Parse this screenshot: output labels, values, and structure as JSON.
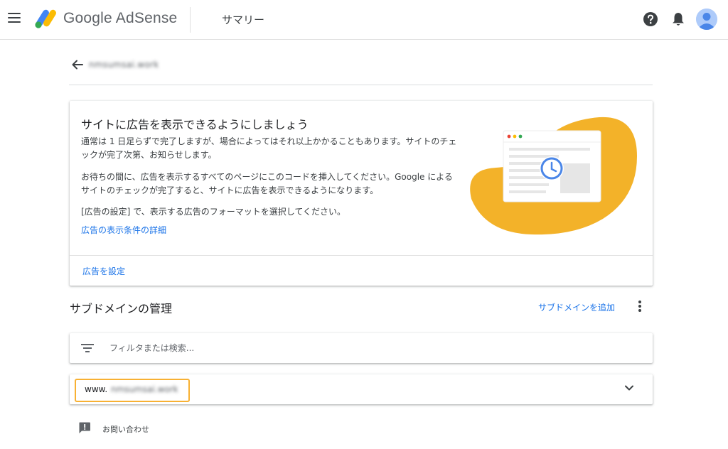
{
  "header": {
    "brand": "Google AdSense",
    "page_title": "サマリー",
    "icons": {
      "menu": "menu-icon",
      "logo": "adsense-logo-icon",
      "help": "help-icon",
      "notifications": "bell-icon",
      "avatar": "avatar-icon"
    }
  },
  "breadcrumb": {
    "site_name": "nmsumsai.work"
  },
  "info_card": {
    "heading": "サイトに広告を表示できるようにしましょう",
    "paragraph_1": "通常は 1 日足らずで完了しますが、場合によってはそれ以上かかることもあります。サイトのチェックが完了次第、お知らせします。",
    "paragraph_2": "お待ちの間に、広告を表示するすべてのページにこのコードを挿入してください。Google によるサイトのチェックが完了すると、サイトに広告を表示できるようになります。",
    "paragraph_3": "[広告の設定] で、表示する広告のフォーマットを選択してください。",
    "details_link": "広告の表示条件の詳細",
    "settings_link": "広告を設定"
  },
  "subdomains": {
    "title": "サブドメインの管理",
    "add_link": "サブドメインを追加",
    "filter_placeholder": "フィルタまたは検索...",
    "rows": [
      {
        "prefix": "www.",
        "domain": "nmsumsai.work"
      }
    ]
  },
  "feedback": {
    "label": "お問い合わせ"
  },
  "colors": {
    "accent_blue": "#1a73e8",
    "illustration_yellow": "#f3b229",
    "highlight_orange": "#f8b133",
    "avatar_blue": "#4a86e8"
  }
}
